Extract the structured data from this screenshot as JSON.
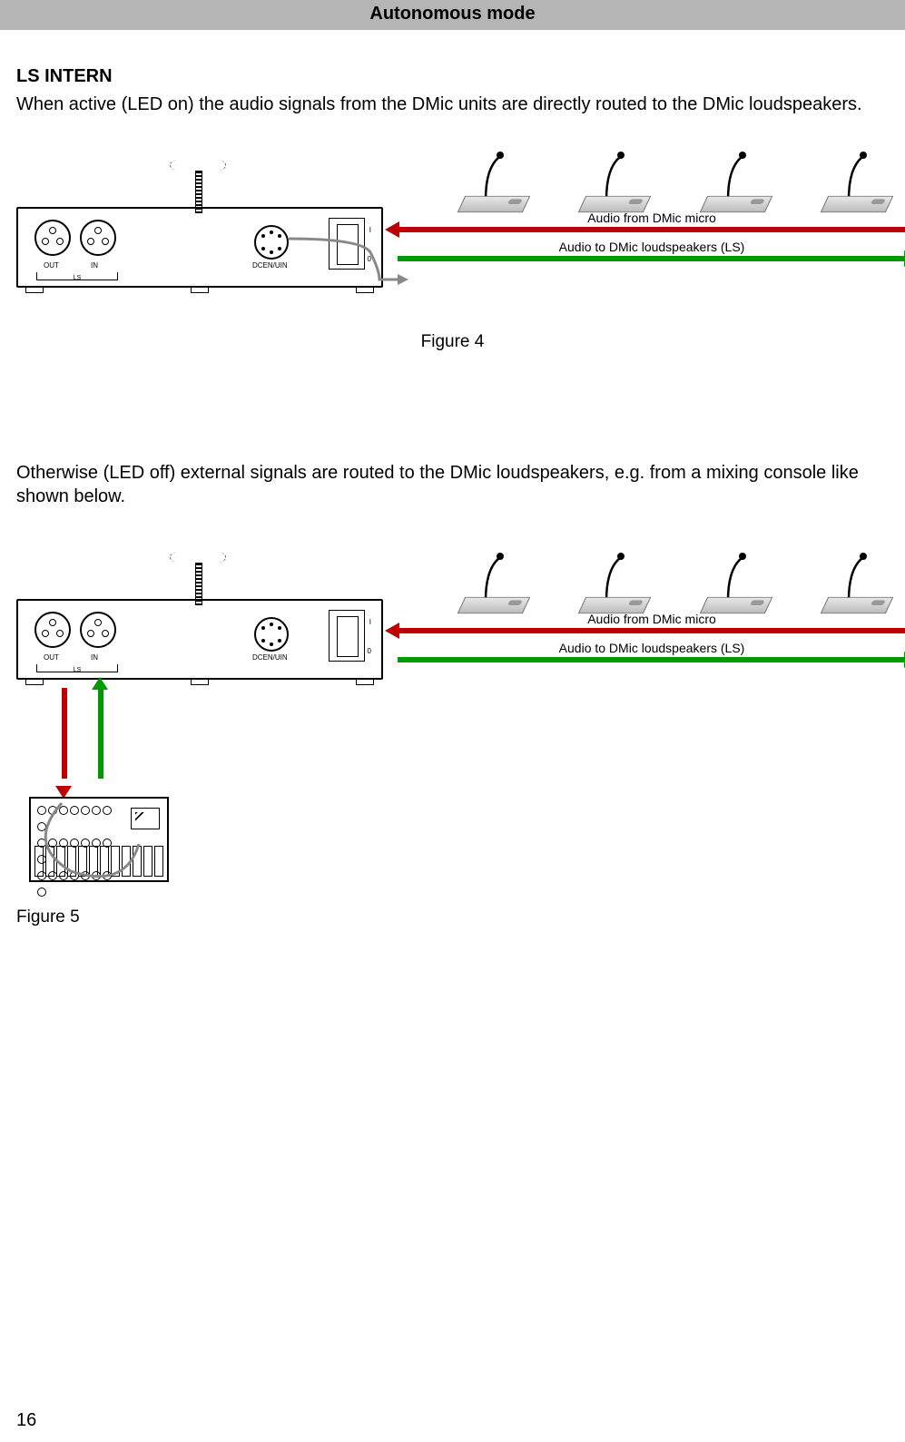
{
  "header": {
    "title": "Autonomous mode"
  },
  "section1": {
    "title": "LS INTERN",
    "body": "When active (LED on) the audio signals from the DMic units are directly routed to the DMic loudspeakers."
  },
  "section2": {
    "body": "Otherwise (LED off) external signals are routed to the DMic loudspeakers, e.g. from a mixing console like shown below."
  },
  "rack_labels": {
    "out": "OUT",
    "in": "IN",
    "ls": "LS",
    "dcn": "DCEN/UIN",
    "sw_on": "I",
    "sw_off": "0"
  },
  "arrows": {
    "from_micro": "Audio from DMic micro",
    "to_ls": "Audio to DMic loudspeakers  (LS)"
  },
  "fig4_caption": "Figure 4",
  "fig5_caption": "Figure 5",
  "page_number": "16"
}
